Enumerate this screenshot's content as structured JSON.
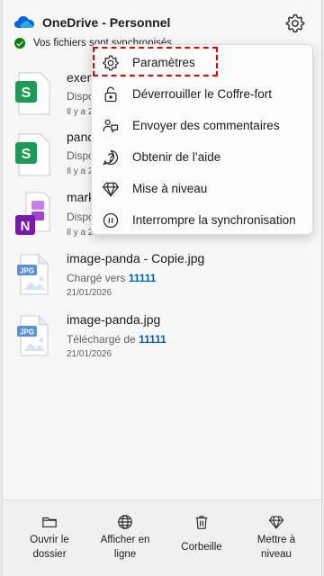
{
  "header": {
    "title": "OneDrive - Personnel",
    "status": "Vos fichiers sont synchronisés",
    "cloud_icon": "onedrive-cloud-icon",
    "settings_icon": "gear-icon",
    "accent": "#0078d4"
  },
  "files": [
    {
      "name": "exer",
      "meta": "Dispo",
      "date": "Il y a 2",
      "icon": "sheets-icon"
    },
    {
      "name": "panc",
      "meta": "Dispo",
      "date": "Il y a 2",
      "icon": "sheets-icon"
    },
    {
      "name": "mark",
      "meta": "Dispo",
      "date": "Il y a 2",
      "icon": "onenote-icon"
    },
    {
      "name": "image-panda - Copie.jpg",
      "meta_prefix": "Chargé vers",
      "meta_link": "11111",
      "date": "21/01/2026",
      "icon": "jpg-icon"
    },
    {
      "name": "image-panda.jpg",
      "meta_prefix": "Téléchargé de",
      "meta_link": "11111",
      "date": "21/01/2026",
      "icon": "jpg-icon"
    }
  ],
  "menu": {
    "items": [
      {
        "label": "Paramètres",
        "icon": "gear-icon"
      },
      {
        "label": "Déverrouiller le Coffre-fort",
        "icon": "lock-icon"
      },
      {
        "label": "Envoyer des commentaires",
        "icon": "feedback-icon"
      },
      {
        "label": "Obtenir de l’aide",
        "icon": "help-icon"
      },
      {
        "label": "Mise à niveau",
        "icon": "diamond-icon"
      },
      {
        "label": "Interrompre la synchronisation",
        "icon": "pause-icon"
      }
    ],
    "highlight_color": "#e00000"
  },
  "toolbar": {
    "buttons": [
      {
        "label": "Ouvrir le\ndossier",
        "icon": "folder-icon"
      },
      {
        "label": "Afficher en\nligne",
        "icon": "globe-icon"
      },
      {
        "label": "Corbeille",
        "icon": "trash-icon"
      },
      {
        "label": "Mettre à\nniveau",
        "icon": "diamond-icon"
      }
    ]
  }
}
